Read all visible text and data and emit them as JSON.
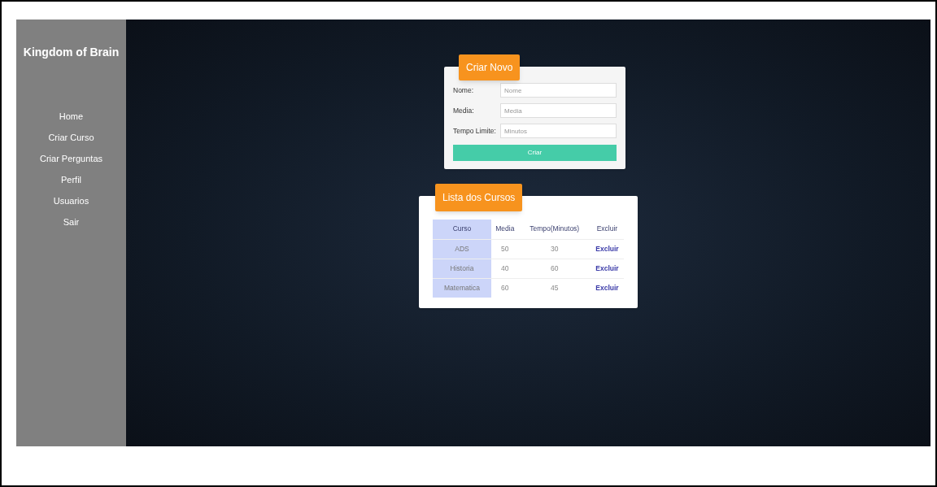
{
  "sidebar": {
    "title": "Kingdom of Brain",
    "items": [
      {
        "label": "Home"
      },
      {
        "label": "Criar Curso"
      },
      {
        "label": "Criar Perguntas"
      },
      {
        "label": "Perfil"
      },
      {
        "label": "Usuarios"
      },
      {
        "label": "Sair"
      }
    ]
  },
  "create_form": {
    "title": "Criar Novo",
    "fields": [
      {
        "label": "Nome:",
        "placeholder": "Nome"
      },
      {
        "label": "Media:",
        "placeholder": "Media"
      },
      {
        "label": "Tempo Limite:",
        "placeholder": "Minutos"
      }
    ],
    "submit": "Criar"
  },
  "course_list": {
    "title": "Lista dos Cursos",
    "columns": [
      "Curso",
      "Media",
      "Tempo(Minutos)",
      "Excluir"
    ],
    "rows": [
      {
        "curso": "ADS",
        "media": "50",
        "tempo": "30",
        "action": "Excluir"
      },
      {
        "curso": "Historia",
        "media": "40",
        "tempo": "60",
        "action": "Excluir"
      },
      {
        "curso": "Matematica",
        "media": "60",
        "tempo": "45",
        "action": "Excluir"
      }
    ]
  }
}
